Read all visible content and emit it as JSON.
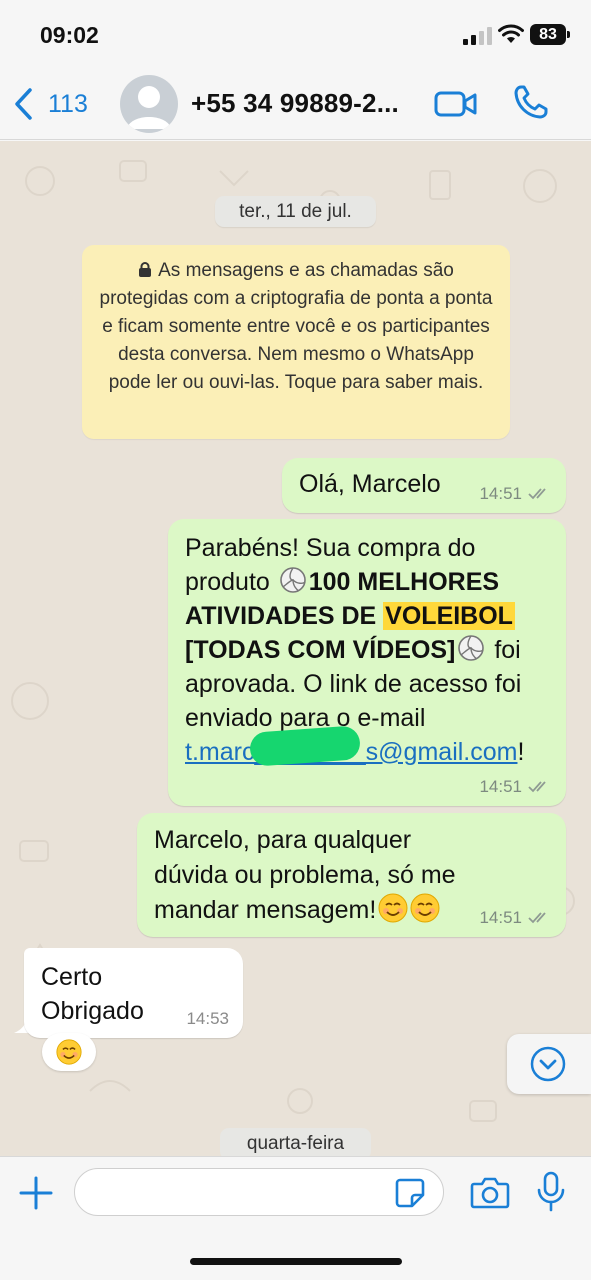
{
  "status_bar": {
    "time": "09:02",
    "battery": "83"
  },
  "header": {
    "back_count": "113",
    "contact_name": "+55 34 99889-2...",
    "icons": [
      "chevron-left-icon",
      "avatar-placeholder-icon",
      "video-call-icon",
      "phone-icon"
    ]
  },
  "chat": {
    "date_label": "ter., 11 de jul.",
    "encryption_notice": "As mensagens e as chamadas são protegidas com a criptografia de ponta a ponta e ficam somente entre você e os participantes desta conversa. Nem mesmo o WhatsApp pode ler ou ouvi-las. Toque para saber mais.",
    "messages": [
      {
        "text": "Olá, Marcelo",
        "time": "14:51"
      },
      {
        "text_1": "Parabéns! Sua compra do produto ",
        "bold_1": "100 MELHORES ATIVIDADES DE ",
        "highlight": "VOLEIBOL",
        "bold_2": " [TODAS COM VÍDEOS]",
        "text_2": " foi aprovada. O link de acesso foi enviado para o e-mail ",
        "email": "t.marc________s@gmail.com",
        "text_3": "!",
        "time": "14:51"
      },
      {
        "text": "Marcelo, para qualquer dúvida ou problema, só me mandar mensagem!",
        "time": "14:51"
      },
      {
        "text": "Certo Obrigado",
        "time": "14:53"
      }
    ],
    "day_label": "quarta-feira"
  },
  "composer": {
    "placeholder": ""
  },
  "colors": {
    "accent": "#1a7fd6",
    "outgoing_bubble": "#dcf8c6",
    "incoming_bubble": "#ffffff",
    "system_notice": "#fbefb7",
    "chat_background": "#e9e2d8",
    "highlight": "#ffd83a"
  }
}
